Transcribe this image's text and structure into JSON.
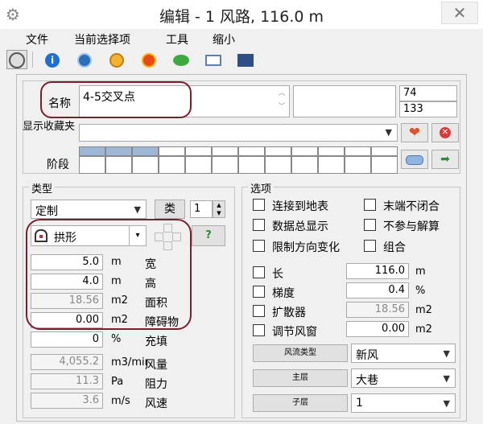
{
  "window": {
    "title": "编辑 - 1 风路, 116.0 m"
  },
  "menu": [
    "文件",
    "当前选择项",
    "工具",
    "缩小"
  ],
  "toolbar": [
    "pointer-icon",
    "info-icon",
    "fan-icon",
    "gauge-icon",
    "swirl-icon",
    "chat-icon",
    "book-icon",
    "chart-icon"
  ],
  "name": {
    "label": "名称",
    "value": "4-5交叉点",
    "num1": "74",
    "num2": "133"
  },
  "favorites": {
    "label": "显示收藏夹"
  },
  "stage": {
    "label": "阶段"
  },
  "type": {
    "group": "类型",
    "select": "定制",
    "class_btn": "类",
    "spin": "1",
    "shape": "拱形",
    "help": "?",
    "rows": [
      {
        "value": "5.0",
        "unit": "m",
        "label": "宽"
      },
      {
        "value": "4.0",
        "unit": "m",
        "label": "高"
      },
      {
        "value": "18.56",
        "unit": "m2",
        "label": "面积"
      },
      {
        "value": "0.00",
        "unit": "m2",
        "label": "障碍物"
      },
      {
        "value": "0",
        "unit": "%",
        "label": "充填"
      },
      {
        "value": "4,055.2",
        "unit": "m3/mir",
        "label": "风量"
      },
      {
        "value": "11.3",
        "unit": "Pa",
        "label": "阻力"
      },
      {
        "value": "3.6",
        "unit": "m/s",
        "label": "风速"
      }
    ]
  },
  "options": {
    "group": "选项",
    "checks": [
      "连接到地表",
      "末端不闭合",
      "数据总显示",
      "不参与解算",
      "限制方向变化",
      "组合"
    ],
    "props": [
      {
        "label": "长",
        "value": "116.0",
        "unit": "m"
      },
      {
        "label": "梯度",
        "value": "0.4",
        "unit": "%"
      },
      {
        "label": "扩散器",
        "value": "18.56",
        "unit": "m2"
      },
      {
        "label": "调节风窗",
        "value": "0.00",
        "unit": "m2"
      }
    ],
    "selects": [
      {
        "button": "风流类型",
        "value": "新风"
      },
      {
        "button": "主层",
        "value": "大巷"
      },
      {
        "button": "子层",
        "value": "1"
      }
    ]
  }
}
